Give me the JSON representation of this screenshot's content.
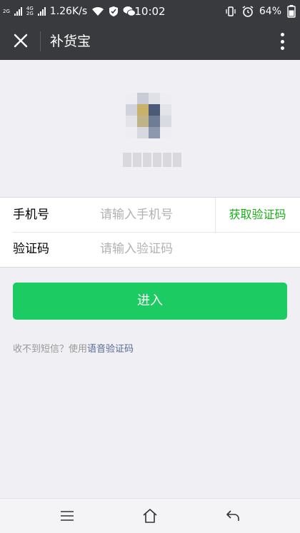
{
  "status_bar": {
    "net_top": "2G",
    "net_mid_top": "4G",
    "net_mid_bottom": "2G",
    "speed": "1.26K/s",
    "time": "10:02",
    "battery": "64%"
  },
  "nav": {
    "title": "补货宝",
    "close_icon": "close-icon",
    "more_icon": "more-vertical-icon"
  },
  "form": {
    "phone_label": "手机号",
    "phone_placeholder": "请输入手机号",
    "get_code_label": "获取验证码",
    "code_label": "验证码",
    "code_placeholder": "请输入验证码"
  },
  "enter_button": {
    "label": "进入"
  },
  "hint": {
    "prefix": "收不到短信？使用",
    "link": "语音验证码"
  },
  "colors": {
    "accent_green": "#1ccb62",
    "link_green": "#1aad19",
    "link_blue": "#576b95",
    "header_bg": "#393a3e"
  }
}
